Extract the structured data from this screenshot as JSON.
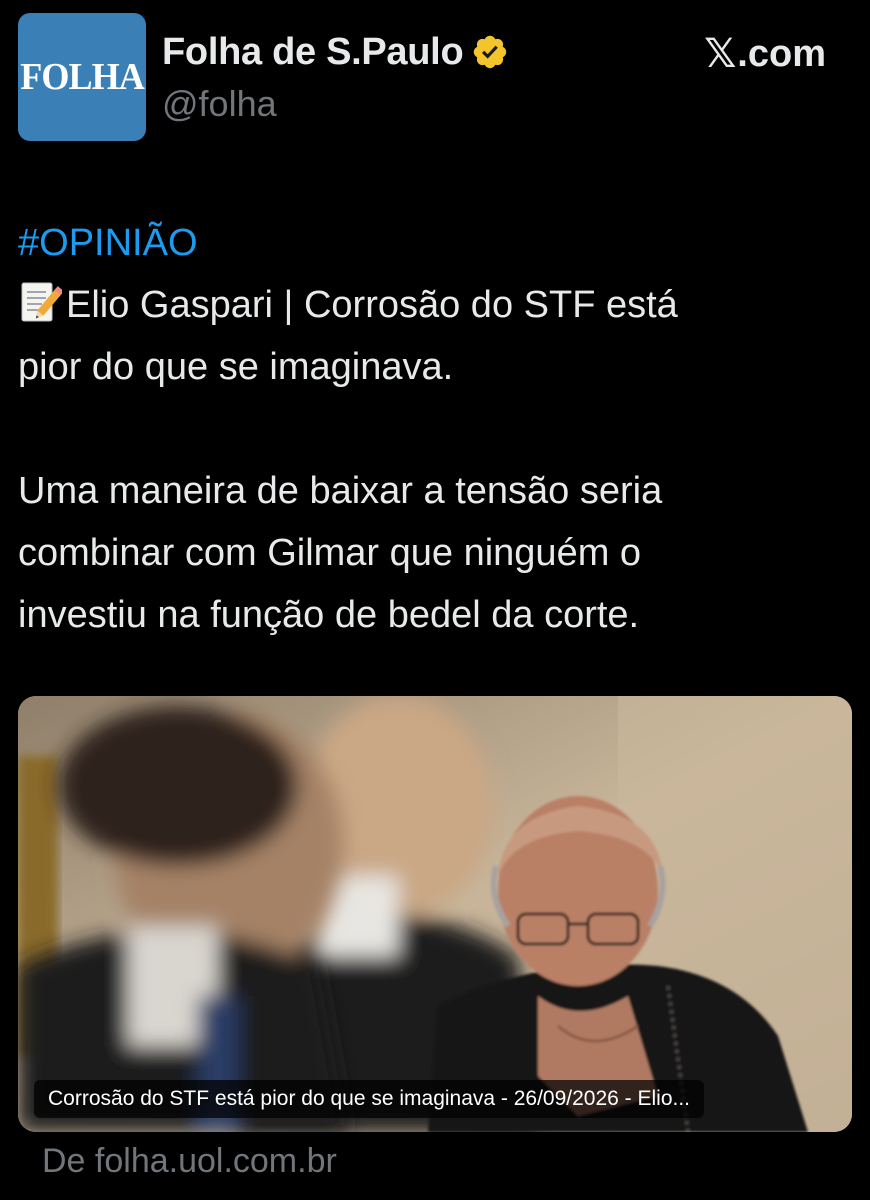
{
  "author": {
    "display_name": "Folha de S.Paulo",
    "handle": "@folha",
    "avatar_text": "FOLHA",
    "verified": true,
    "verified_color": "#f4c42d"
  },
  "platform": {
    "logo": "x-logo",
    "domain": ".com"
  },
  "tweet": {
    "hashtag": "#OPINIÃO",
    "line1": "Elio Gaspari | Corrosão do STF está",
    "line2": "pior do que se imaginava.",
    "line3": "Uma maneira de baixar a tensão seria",
    "line4": "combinar com Gilmar que ninguém o",
    "line5": "investiu na função de bedel da corte."
  },
  "link_card": {
    "image_icon": "photo-of-judges",
    "caption": "Corrosão do STF está pior do que se imaginava - 26/09/2026 - Elio...",
    "source": "De folha.uol.com.br"
  },
  "colors": {
    "background": "#000000",
    "text": "#e7e9ea",
    "secondary": "#71767b",
    "link": "#1d9bf0",
    "avatar_bg": "#3a7fb5"
  }
}
